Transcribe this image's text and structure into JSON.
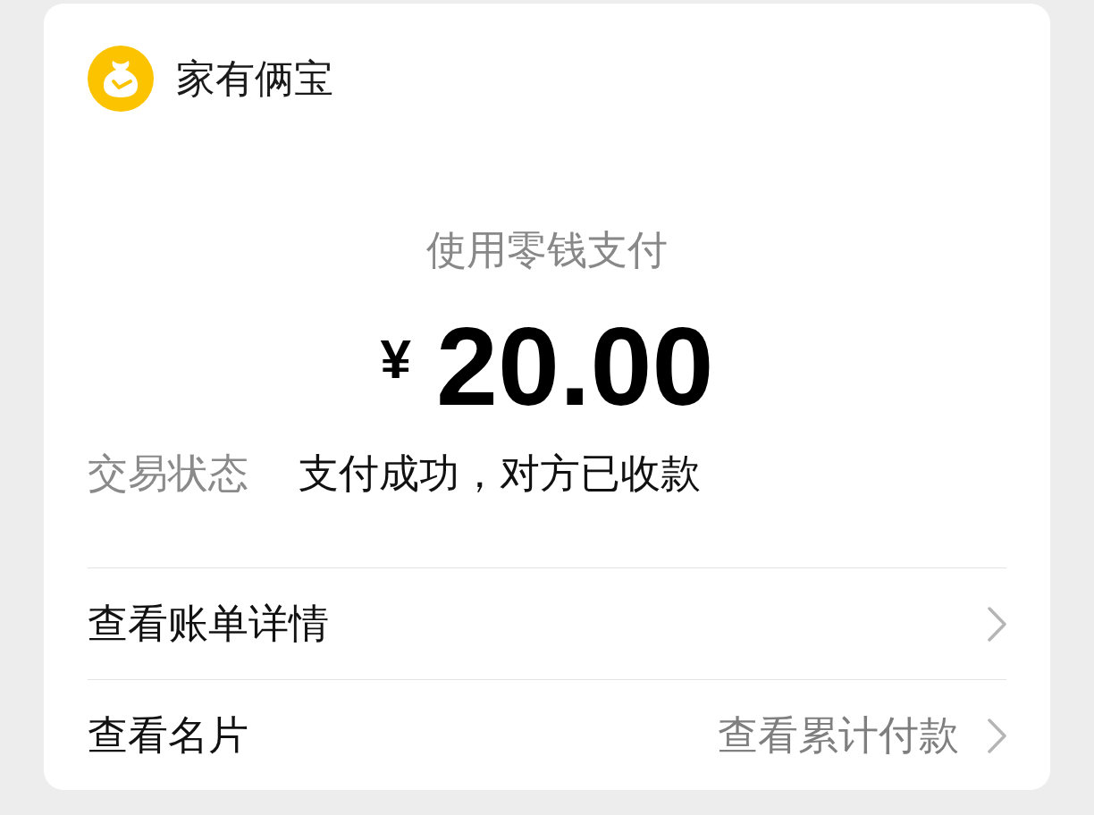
{
  "merchant": {
    "name": "家有俩宝"
  },
  "payment_method": "使用零钱支付",
  "amount": {
    "currency": "¥",
    "value": "20.00"
  },
  "details": [
    {
      "label": "交易状态",
      "value": "支付成功，对方已收款"
    }
  ],
  "links": [
    {
      "label": "查看账单详情"
    },
    {
      "label": "查看名片",
      "hint": "查看累计付款"
    }
  ]
}
